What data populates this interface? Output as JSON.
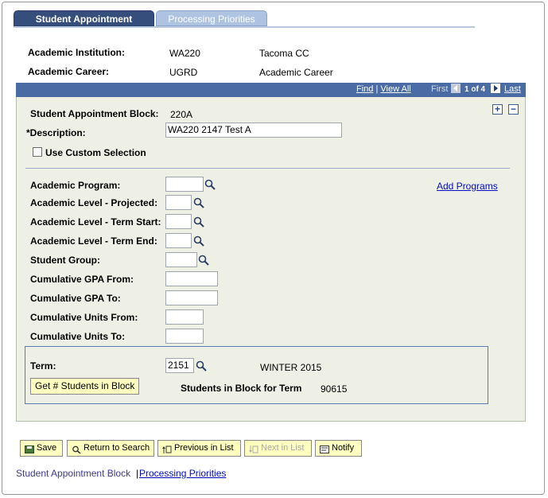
{
  "tabs": {
    "active": "Student Appointment Block",
    "inactive": "Processing Priorities"
  },
  "header": {
    "institution_label": "Academic Institution:",
    "institution_code": "WA220",
    "institution_name": "Tacoma CC",
    "career_label": "Academic Career:",
    "career_code": "UGRD",
    "career_name": "Academic Career"
  },
  "scroll_nav": {
    "find": "Find",
    "separator": "|",
    "view_all": "View All",
    "first": "First",
    "position": "1 of 4",
    "last": "Last"
  },
  "form": {
    "block_label": "Student Appointment Block:",
    "block_value": "220A",
    "description_label": "*Description:",
    "description_value": "WA220 2147 Test A",
    "custom_selection_label": "Use Custom Selection",
    "add_programs": "Add Programs",
    "academic_program_label": "Academic Program:",
    "level_projected_label": "Academic Level - Projected:",
    "level_term_start_label": "Academic Level - Term Start:",
    "level_term_end_label": "Academic Level - Term End:",
    "student_group_label": "Student Group:",
    "gpa_from_label": "Cumulative GPA From:",
    "gpa_to_label": "Cumulative GPA To:",
    "units_from_label": "Cumulative Units From:",
    "units_to_label": "Cumulative Units To:",
    "term_label": "Term:",
    "term_value": "2151",
    "term_desc": "WINTER 2015",
    "get_students_button": "Get # Students in Block",
    "students_in_block_label": "Students in Block for Term",
    "students_in_block_value": "90615"
  },
  "toolbar": {
    "save": "Save",
    "return_to_search": "Return to Search",
    "previous_in_list": "Previous in List",
    "next_in_list": "Next in List",
    "notify": "Notify"
  },
  "footer_links": {
    "link1": "Student Appointment Block",
    "separator": "|",
    "link2": "Processing Priorities"
  },
  "colors": {
    "tab_active": "#354e7c",
    "tab_inactive": "#aec3e2",
    "scroll_header": "#4a6ba3",
    "panel_bg": "#eef0e6",
    "button_bg": "#ffffc0",
    "link": "#000cc3"
  }
}
